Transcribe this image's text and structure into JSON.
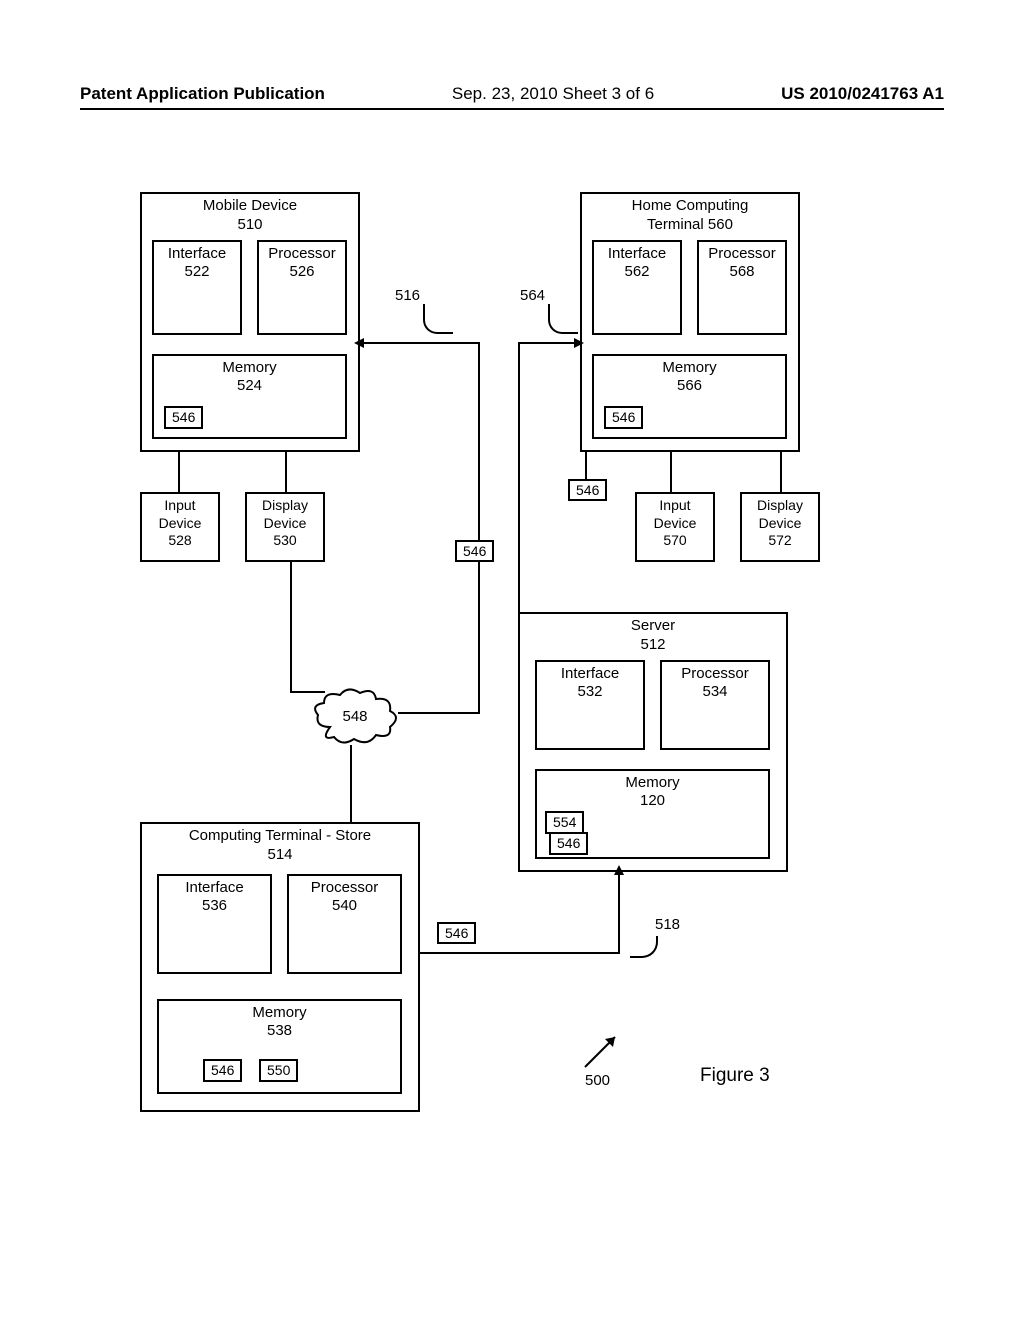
{
  "header": {
    "left": "Patent Application Publication",
    "center": "Sep. 23, 2010  Sheet 3 of 6",
    "right": "US 2010/0241763 A1"
  },
  "mobile": {
    "title": "Mobile Device",
    "ref": "510",
    "interface": {
      "title": "Interface",
      "ref": "522"
    },
    "processor": {
      "title": "Processor",
      "ref": "526"
    },
    "memory": {
      "title": "Memory",
      "ref": "524",
      "tag": "546"
    },
    "input": {
      "title": "Input\nDevice",
      "ref": "528"
    },
    "display": {
      "title": "Display\nDevice",
      "ref": "530"
    }
  },
  "home": {
    "title": "Home Computing",
    "title2": "Terminal 560",
    "interface": {
      "title": "Interface",
      "ref": "562"
    },
    "processor": {
      "title": "Processor",
      "ref": "568"
    },
    "memory": {
      "title": "Memory",
      "ref": "566",
      "tag": "546"
    },
    "input": {
      "title": "Input\nDevice",
      "ref": "570"
    },
    "display": {
      "title": "Display\nDevice",
      "ref": "572"
    },
    "extra_tag": "546"
  },
  "server": {
    "title": "Server",
    "ref": "512",
    "interface": {
      "title": "Interface",
      "ref": "532"
    },
    "processor": {
      "title": "Processor",
      "ref": "534"
    },
    "memory": {
      "title": "Memory",
      "ref": "120",
      "tag_outer": "554",
      "tag_inner": "546"
    }
  },
  "store": {
    "title": "Computing Terminal - Store",
    "ref": "514",
    "interface": {
      "title": "Interface",
      "ref": "536"
    },
    "processor": {
      "title": "Processor",
      "ref": "540"
    },
    "memory": {
      "title": "Memory",
      "ref": "538",
      "tag1": "546",
      "tag2": "550"
    }
  },
  "lines": {
    "l516": "516",
    "l564": "564",
    "l548": "548",
    "l518": "518",
    "l546_left": "546",
    "l500": "500"
  },
  "figure_label": "Figure 3"
}
